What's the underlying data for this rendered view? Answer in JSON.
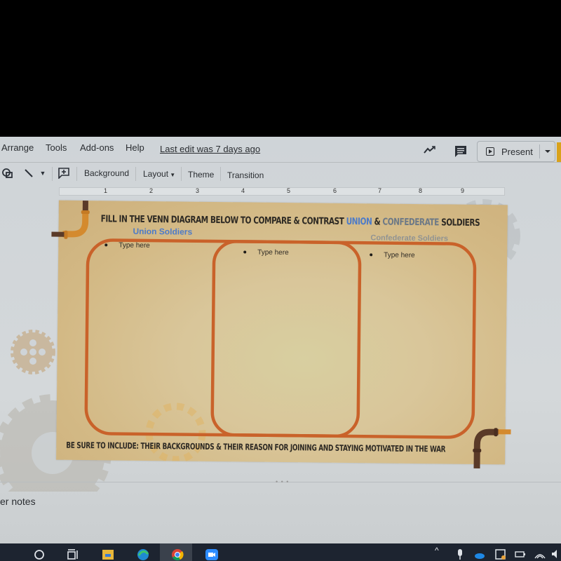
{
  "menu": {
    "items": [
      "Arrange",
      "Tools",
      "Add-ons",
      "Help"
    ],
    "last_edit": "Last edit was 7 days ago"
  },
  "header_actions": {
    "activity_icon": "trend-line-icon",
    "comments_icon": "comment-icon",
    "present_label": "Present"
  },
  "toolbar": {
    "background_label": "Background",
    "layout_label": "Layout",
    "theme_label": "Theme",
    "transition_label": "Transition"
  },
  "ruler": {
    "ticks": [
      "1",
      "2",
      "3",
      "4",
      "5",
      "6",
      "7",
      "8",
      "9"
    ]
  },
  "slide": {
    "title_prefix": "FILL IN THE VENN DIAGRAM BELOW TO COMPARE & CONTRAST ",
    "title_union": "UNION",
    "title_mid": " & ",
    "title_conf": "CONFEDERATE",
    "title_suffix": " SOLDIERS",
    "label_union": "Union Soldiers",
    "label_confederate": "Confederate Soldiers",
    "bullets": [
      {
        "text": "Type here",
        "region": "union"
      },
      {
        "text": "Type here",
        "region": "both"
      },
      {
        "text": "Type here",
        "region": "confederate"
      }
    ],
    "footer": "BE SURE TO INCLUDE: THEIR BACKGROUNDS & THEIR REASON FOR JOINING AND STAYING MOTIVATED IN THE WAR",
    "colors": {
      "venn_outline": "#c9622a",
      "union": "#4d7bc8",
      "confederate": "#6d7986",
      "pipe_orange": "#d48a2e",
      "pipe_brown": "#5a3a28"
    }
  },
  "notes": {
    "label": "er notes"
  },
  "taskbar": {
    "apps": [
      "search-icon",
      "task-view-icon",
      "file-explorer-icon",
      "edge-icon",
      "chrome-icon",
      "zoom-icon"
    ],
    "tray": [
      "chevron-up-icon",
      "microphone-icon",
      "onedrive-icon",
      "meet-now-icon",
      "battery-icon",
      "wifi-icon",
      "volume-icon"
    ]
  }
}
